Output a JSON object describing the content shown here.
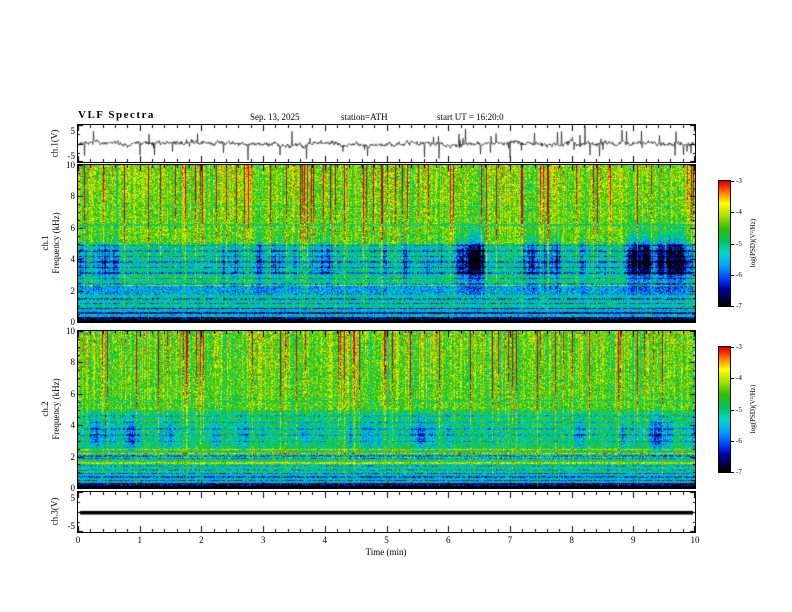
{
  "header": {
    "title": "VLF  Spectra",
    "date": "Sep. 13, 2025",
    "station": "station=ATH",
    "start_ut": "start UT  =   16:20:0"
  },
  "xaxis": {
    "label": "Time  (min)",
    "ticks": [
      "0",
      "1",
      "2",
      "3",
      "4",
      "5",
      "6",
      "7",
      "8",
      "9",
      "10"
    ],
    "range": [
      0,
      10
    ]
  },
  "panels": [
    {
      "ylabel": "ch.1(V)",
      "yticks": [
        "5",
        "-5"
      ]
    },
    {
      "channel": "ch.1",
      "ylabel": "Frequency  (kHz)",
      "yticks": [
        "10",
        "8",
        "6",
        "4",
        "2",
        "0"
      ]
    },
    {
      "channel": "ch.2",
      "ylabel": "Frequency  (kHz)",
      "yticks": [
        "10",
        "8",
        "6",
        "4",
        "2",
        "0"
      ]
    },
    {
      "ylabel": "ch.3(V)",
      "yticks": [
        "5",
        "-5"
      ]
    }
  ],
  "colorbar": {
    "label": "log(PSD)(V²/Hz)",
    "ticks": [
      "-3",
      "-4",
      "-5",
      "-6",
      "-7"
    ]
  },
  "chart_data": [
    {
      "type": "line",
      "name": "ch.1 waveform",
      "ylabel": "ch.1(V)",
      "ylim": [
        -5,
        5
      ],
      "xlabel": "Time (min)",
      "xlim": [
        0,
        10
      ],
      "description": "Noisy broadband VLF waveform centred near 0 V with dense impulsive spikes (sferics) reaching about ±5 V across the whole 10-minute record.",
      "render": {
        "seed": 7,
        "noise": 0.9,
        "spike_prob": 0.04
      }
    },
    {
      "type": "heatmap",
      "name": "ch.1 spectrogram",
      "ylabel": "ch.1 Frequency (kHz)",
      "ylim": [
        0,
        10
      ],
      "xlim": [
        0,
        10
      ],
      "zlabel": "log(PSD)(V²/Hz)",
      "zlim": [
        -7,
        -3
      ],
      "description": "Spectrogram 0-10 kHz: green/yellow broadband background above 5 kHz with many vertical impulsive streaks (red tips at top); dark-blue patches 2.5-5 kHz; blue band near 2 kHz; dark horizontal harmonic lines below 5 kHz; black band below ~0.3 kHz.",
      "render": {
        "seed": 101,
        "streak_strong": 0.1,
        "streak_med": 0.35,
        "bands": [
          [
            5,
            10,
            0.62
          ],
          [
            4,
            5,
            0.48
          ],
          [
            3,
            4,
            0.45
          ],
          [
            2.3,
            3,
            0.52
          ],
          [
            1.75,
            2.3,
            0.33
          ],
          [
            1.0,
            1.75,
            0.47
          ],
          [
            0.35,
            1.0,
            0.38
          ],
          [
            0.15,
            0.35,
            0.07
          ],
          [
            0,
            0.15,
            0
          ]
        ],
        "dark_lines": [
          [
            0.6,
            0.25
          ],
          [
            0.9,
            0.22
          ],
          [
            1.2,
            0.2
          ],
          [
            1.5,
            0.2
          ],
          [
            2.45,
            0.18
          ],
          [
            2.8,
            0.18
          ],
          [
            3.15,
            0.18
          ],
          [
            3.5,
            0.18
          ],
          [
            3.85,
            0.18
          ],
          [
            4.2,
            0.18
          ],
          [
            4.55,
            0.18
          ],
          [
            4.9,
            0.15
          ],
          [
            6.2,
            0.12
          ],
          [
            7.4,
            0.1
          ]
        ],
        "bright_lines": [
          [
            2.35,
            0.15
          ]
        ],
        "patch_center": 4.0,
        "patch_width": 1.1,
        "patch_strength": 0.5,
        "colormap": [
          [
            0,
            "#000000"
          ],
          [
            0.06,
            "#000040"
          ],
          [
            0.14,
            "#0000a8"
          ],
          [
            0.22,
            "#0040ff"
          ],
          [
            0.32,
            "#00a0ff"
          ],
          [
            0.42,
            "#00d8c8"
          ],
          [
            0.52,
            "#00c060"
          ],
          [
            0.62,
            "#30c000"
          ],
          [
            0.72,
            "#a8e000"
          ],
          [
            0.82,
            "#ffff00"
          ],
          [
            0.9,
            "#ff8800"
          ],
          [
            0.96,
            "#ff2200"
          ],
          [
            1,
            "#cc0000"
          ]
        ]
      }
    },
    {
      "type": "heatmap",
      "name": "ch.2 spectrogram",
      "ylabel": "ch.2 Frequency (kHz)",
      "ylim": [
        0,
        10
      ],
      "xlim": [
        0,
        10
      ],
      "zlabel": "log(PSD)(V²/Hz)",
      "zlim": [
        -7,
        -3
      ],
      "description": "Spectrogram 0-10 kHz: green/yellow background with vertical impulsive streaks above 5 kHz; cyan/green band 2.6-4.3 kHz with blue speckle; bright yellow horizontal lines near 1.6-2.5 kHz; dark blue band near 2 kHz; alternating dark rows below 1 kHz; black band below ~0.3 kHz.",
      "render": {
        "seed": 202,
        "streak_strong": 0.09,
        "streak_med": 0.33,
        "bands": [
          [
            5,
            10,
            0.6
          ],
          [
            4.3,
            5,
            0.52
          ],
          [
            2.6,
            4.3,
            0.5
          ],
          [
            2.15,
            2.6,
            0.55
          ],
          [
            1.85,
            2.15,
            0.3
          ],
          [
            1.0,
            1.85,
            0.52
          ],
          [
            0.35,
            1.0,
            0.42
          ],
          [
            0.15,
            0.35,
            0.09
          ],
          [
            0,
            0.15,
            0
          ]
        ],
        "dark_lines": [
          [
            0.5,
            0.22
          ],
          [
            0.72,
            0.2
          ],
          [
            0.95,
            0.18
          ],
          [
            1.18,
            0.18
          ],
          [
            1.42,
            0.16
          ],
          [
            3.0,
            0.14
          ],
          [
            3.4,
            0.14
          ],
          [
            3.8,
            0.14
          ],
          [
            4.2,
            0.14
          ],
          [
            4.6,
            0.14
          ],
          [
            5.6,
            0.1
          ]
        ],
        "bright_lines": [
          [
            1.62,
            0.22
          ],
          [
            1.98,
            0.32
          ],
          [
            2.22,
            0.3
          ],
          [
            2.48,
            0.2
          ]
        ],
        "patch_center": 3.4,
        "patch_width": 0.8,
        "patch_strength": 0.3
      }
    },
    {
      "type": "line",
      "name": "ch.3 waveform",
      "ylabel": "ch.3(V)",
      "ylim": [
        -5,
        5
      ],
      "xlim": [
        0,
        10
      ],
      "description": "Flat thick black trace, constant at about 0 V for the whole record (channel inactive).",
      "render": {
        "value": -0.2
      }
    }
  ]
}
